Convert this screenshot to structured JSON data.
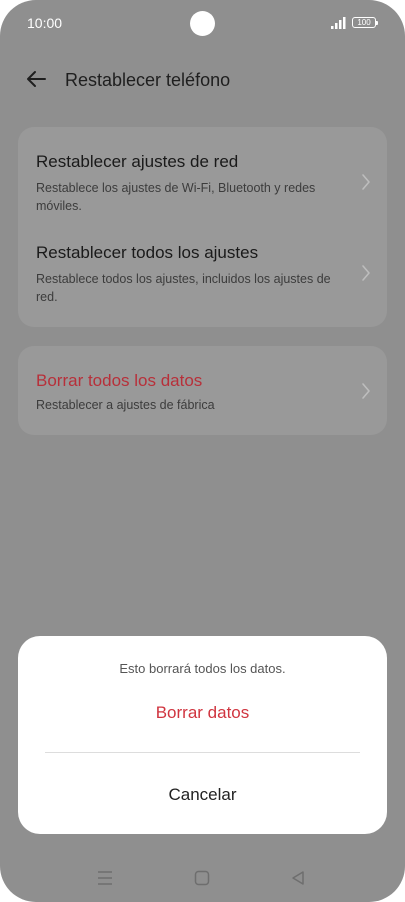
{
  "status_bar": {
    "time": "10:00",
    "battery": "100"
  },
  "app_bar": {
    "title": "Restablecer teléfono"
  },
  "card1": {
    "items": [
      {
        "title": "Restablecer ajustes de red",
        "subtitle": "Restablece los ajustes de Wi-Fi, Bluetooth y redes móviles."
      },
      {
        "title": "Restablecer todos los ajustes",
        "subtitle": "Restablece todos los ajustes, incluidos los ajustes de red."
      }
    ]
  },
  "card2": {
    "items": [
      {
        "title": "Borrar todos los datos",
        "subtitle": "Restablecer a ajustes de fábrica"
      }
    ]
  },
  "dialog": {
    "message": "Esto borrará todos los datos.",
    "confirm_label": "Borrar datos",
    "cancel_label": "Cancelar"
  },
  "colors": {
    "danger": "#d0343f",
    "scrim": "#8f8f8f"
  },
  "icons": {
    "back": "arrow-left-icon",
    "chevron": "chevron-right-icon",
    "nav_menu": "menu-icon",
    "nav_home": "home-icon",
    "nav_back": "back-triangle-icon"
  }
}
